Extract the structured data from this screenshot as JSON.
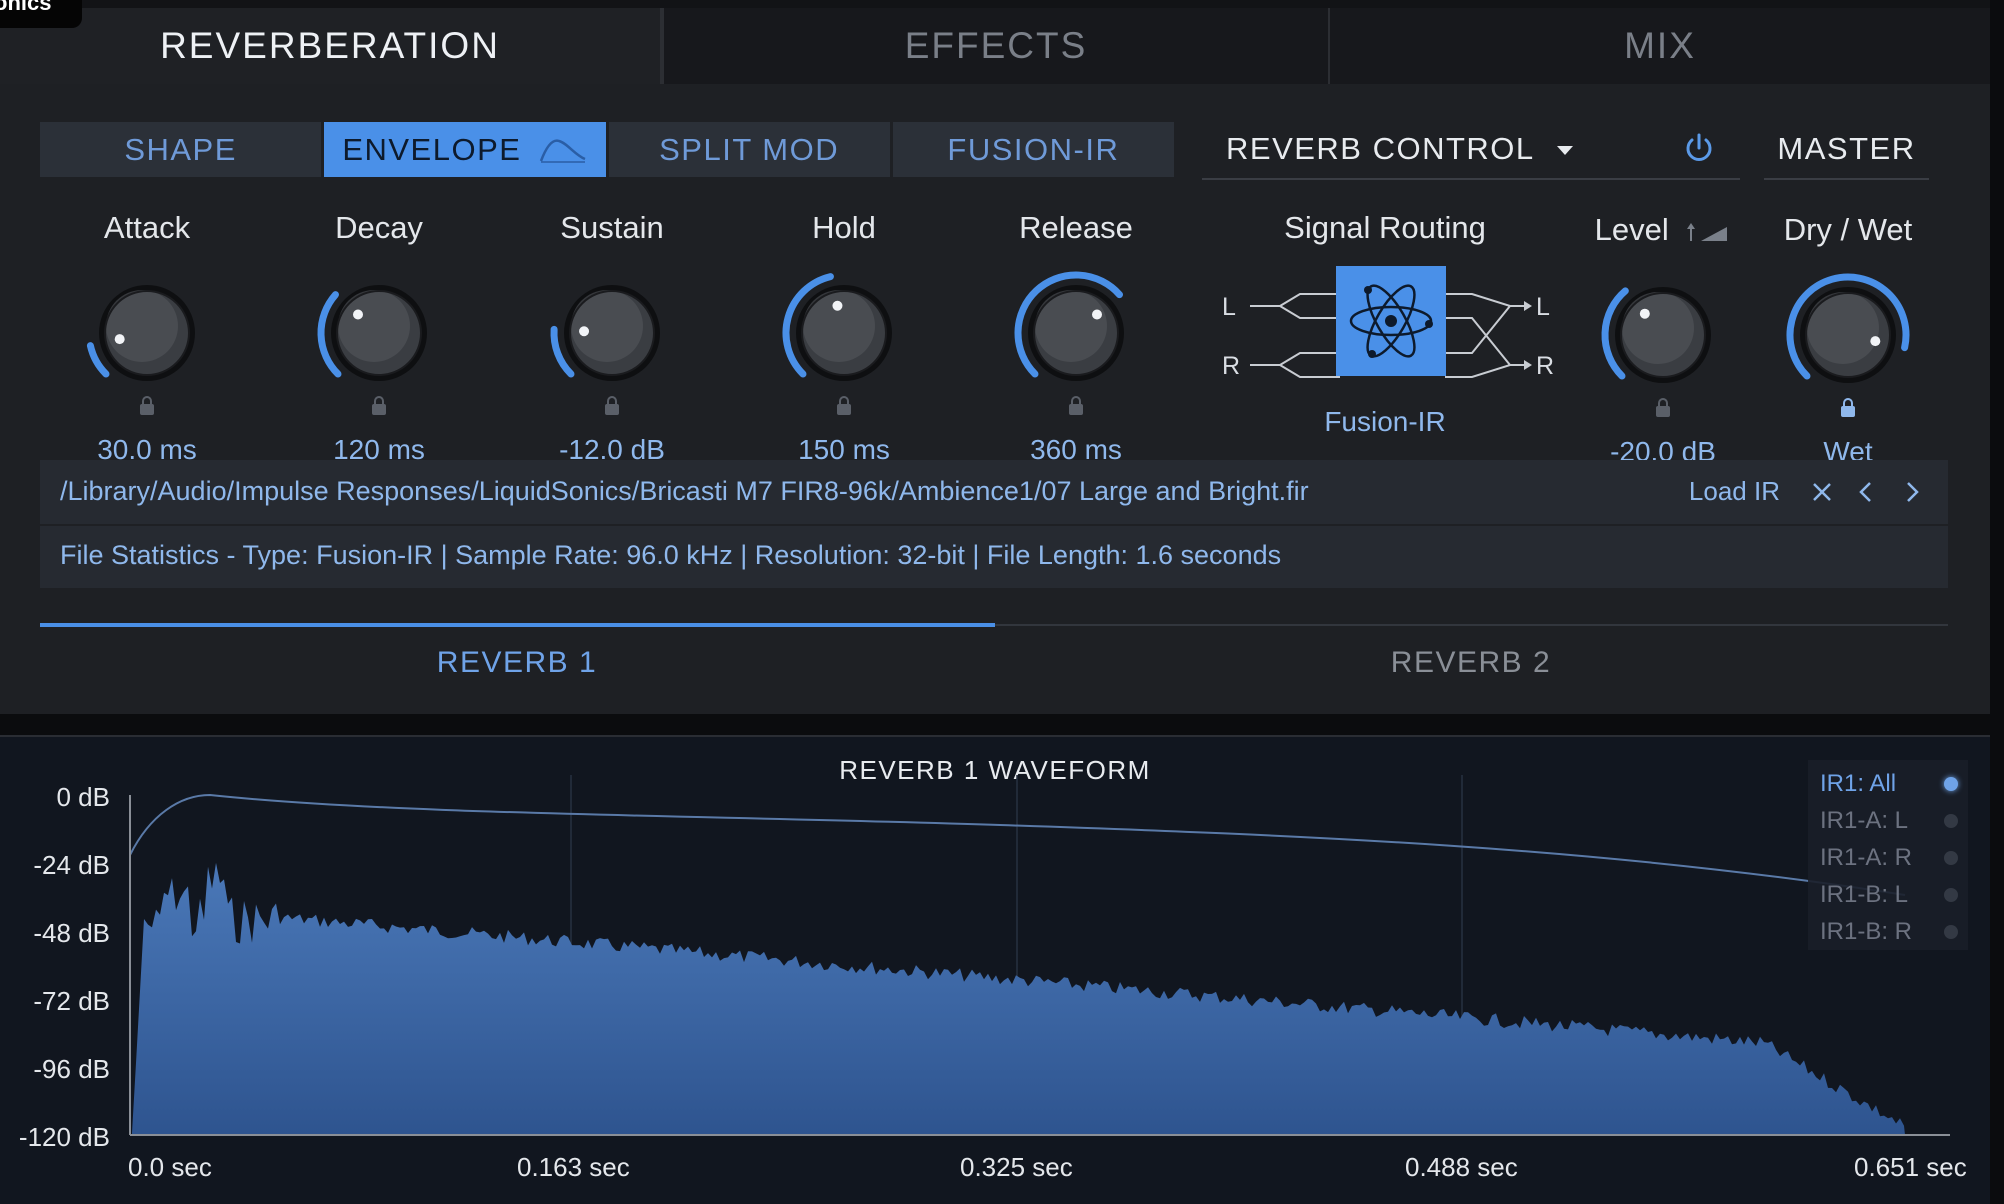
{
  "brand_fragment": "onics",
  "main_tabs": [
    {
      "label": "REVERBERATION",
      "active": true
    },
    {
      "label": "EFFECTS",
      "active": false
    },
    {
      "label": "MIX",
      "active": false
    }
  ],
  "sub_tabs": [
    {
      "label": "SHAPE",
      "active": false
    },
    {
      "label": "ENVELOPE",
      "active": true
    },
    {
      "label": "SPLIT MOD",
      "active": false
    },
    {
      "label": "FUSION-IR",
      "active": false
    }
  ],
  "reverb_control": {
    "label": "REVERB CONTROL",
    "master_label": "MASTER"
  },
  "knobs": [
    {
      "label": "Attack",
      "value": "30.0 ms",
      "fraction": 0.12
    },
    {
      "label": "Decay",
      "value": "120 ms",
      "fraction": 0.32
    },
    {
      "label": "Sustain",
      "value": "-12.0 dB",
      "fraction": 0.18
    },
    {
      "label": "Hold",
      "value": "150 ms",
      "fraction": 0.45
    },
    {
      "label": "Release",
      "value": "360 ms",
      "fraction": 0.68
    }
  ],
  "signal_routing": {
    "label": "Signal Routing",
    "mode": "Fusion-IR",
    "in_left": "L",
    "in_right": "R",
    "out_left": "L",
    "out_right": "R"
  },
  "level_knob": {
    "label": "Level",
    "value": "-20.0 dB",
    "fraction": 0.35
  },
  "drywet_knob": {
    "label": "Dry / Wet",
    "value": "Wet",
    "fraction": 0.88
  },
  "file": {
    "path": "/Library/Audio/Impulse Responses/LiquidSonics/Bricasti M7 FIR8-96k/Ambience1/07 Large and Bright.fir",
    "stats": "File Statistics - Type: Fusion-IR | Sample Rate: 96.0 kHz | Resolution: 32-bit | File Length: 1.6 seconds",
    "load_label": "Load IR"
  },
  "reverb_tabs": [
    {
      "label": "REVERB 1",
      "active": true
    },
    {
      "label": "REVERB 2",
      "active": false
    }
  ],
  "colors": {
    "accent": "#4a90e8",
    "text_blue": "#8fb8ec",
    "panel": "#1e2024",
    "waveform_fill": "#3f6aa8"
  },
  "waveform": {
    "title": "REVERB 1 WAVEFORM",
    "y_labels": [
      "0 dB",
      "-24 dB",
      "-48 dB",
      "-72 dB",
      "-96 dB",
      "-120 dB"
    ],
    "x_labels": [
      "0.0 sec",
      "0.163 sec",
      "0.325 sec",
      "0.488 sec",
      "0.651 sec"
    ],
    "legend": [
      {
        "label": "IR1: All",
        "active": true
      },
      {
        "label": "IR1-A: L",
        "active": false
      },
      {
        "label": "IR1-A: R",
        "active": false
      },
      {
        "label": "IR1-B: L",
        "active": false
      },
      {
        "label": "IR1-B: R",
        "active": false
      }
    ]
  }
}
